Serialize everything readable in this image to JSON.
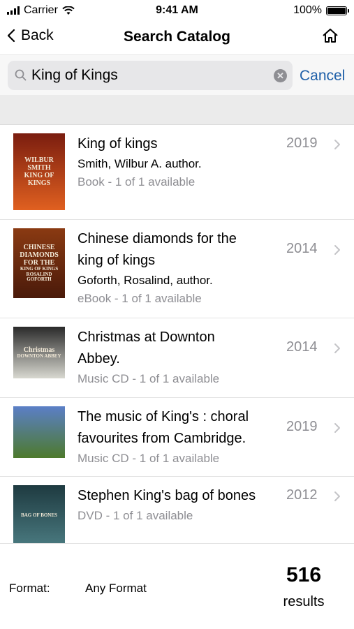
{
  "status_bar": {
    "carrier": "Carrier",
    "time": "9:41 AM",
    "battery": "100%"
  },
  "nav": {
    "back_label": "Back",
    "title": "Search Catalog",
    "home_icon": "home-icon"
  },
  "search": {
    "query": "King of Kings",
    "cancel_label": "Cancel"
  },
  "results": [
    {
      "title_lines": [
        "King of kings"
      ],
      "author": "Smith, Wilbur A. author.",
      "format": "Book - 1 of 1 available",
      "year": "2019",
      "cover": {
        "text": [
          "WILBUR",
          "SMITH",
          "KING OF",
          "KINGS"
        ],
        "colors": [
          "#7a1d0f",
          "#e06020"
        ]
      }
    },
    {
      "title_lines": [
        "Chinese diamonds for the",
        "king of kings"
      ],
      "author": "Goforth, Rosalind, author.",
      "format": "eBook - 1 of 1 available",
      "year": "2014",
      "cover": {
        "text": [
          "CHINESE",
          "DIAMONDS",
          "FOR THE",
          "KING OF KINGS",
          "ROSALIND GOFORTH"
        ],
        "colors": [
          "#8a3a12",
          "#4a1a0a"
        ]
      }
    },
    {
      "title_lines": [
        "Christmas at Downton",
        "Abbey."
      ],
      "author": "",
      "format": "Music CD - 1 of 1 available",
      "year": "2014",
      "cover": {
        "text": [
          "Christmas",
          "DOWNTON ABBEY"
        ],
        "colors": [
          "#2a2a2a",
          "#d8d8d0"
        ]
      }
    },
    {
      "title_lines": [
        "The music of King's : choral",
        "favourites from Cambridge."
      ],
      "author": "",
      "format": "Music CD - 1 of 1 available",
      "year": "2019",
      "cover": {
        "text": [],
        "colors": [
          "#5b7fc7",
          "#4d7a2c"
        ]
      }
    },
    {
      "title_lines": [
        "Stephen King's bag of bones"
      ],
      "author": "",
      "format": "DVD - 1 of 1 available",
      "year": "2012",
      "cover": {
        "text": [
          "BAG OF BONES"
        ],
        "colors": [
          "#1e3a40",
          "#4a7a80"
        ]
      }
    }
  ],
  "footer": {
    "format_label": "Format:",
    "format_value": "Any Format",
    "count": "516",
    "count_label": "results"
  }
}
